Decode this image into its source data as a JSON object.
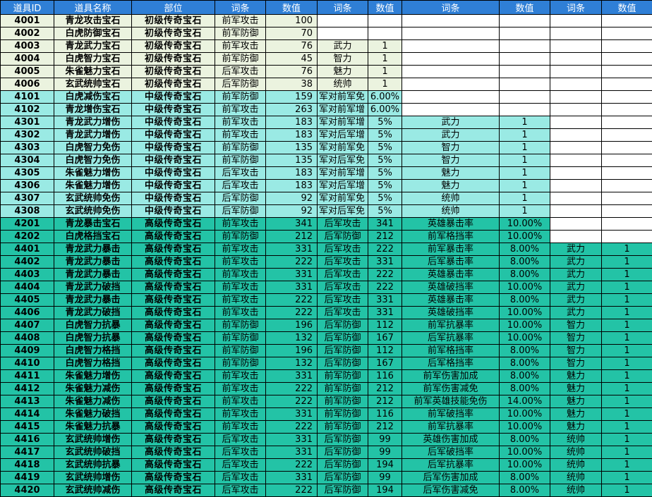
{
  "headers": [
    "道具ID",
    "道具名称",
    "部位",
    "词条",
    "数值",
    "词条",
    "数值",
    "词条",
    "数值",
    "词条",
    "数值"
  ],
  "rows": [
    {
      "tier": "tier1",
      "cells": [
        "4001",
        "青龙攻击宝石",
        "初级传奇宝石",
        "前军攻击",
        "100",
        "",
        "",
        "",
        "",
        "",
        ""
      ]
    },
    {
      "tier": "tier1",
      "cells": [
        "4002",
        "白虎防御宝石",
        "初级传奇宝石",
        "前军防御",
        "70",
        "",
        "",
        "",
        "",
        "",
        ""
      ]
    },
    {
      "tier": "tier1",
      "cells": [
        "4003",
        "青龙武力宝石",
        "初级传奇宝石",
        "前军攻击",
        "76",
        "武力",
        "1",
        "",
        "",
        "",
        ""
      ]
    },
    {
      "tier": "tier1",
      "cells": [
        "4004",
        "白虎智力宝石",
        "初级传奇宝石",
        "前军防御",
        "45",
        "智力",
        "1",
        "",
        "",
        "",
        ""
      ]
    },
    {
      "tier": "tier1",
      "cells": [
        "4005",
        "朱雀魅力宝石",
        "初级传奇宝石",
        "后军攻击",
        "76",
        "魅力",
        "1",
        "",
        "",
        "",
        ""
      ]
    },
    {
      "tier": "tier1",
      "cells": [
        "4006",
        "玄武统帅宝石",
        "初级传奇宝石",
        "后军防御",
        "38",
        "统帅",
        "1",
        "",
        "",
        "",
        ""
      ]
    },
    {
      "tier": "tier2",
      "cells": [
        "4101",
        "白虎减伤宝石",
        "中级传奇宝石",
        "前军防御",
        "159",
        "军对前军免",
        "6.00%",
        "",
        "",
        "",
        ""
      ]
    },
    {
      "tier": "tier2",
      "cells": [
        "4102",
        "青龙增伤宝石",
        "中级传奇宝石",
        "前军攻击",
        "263",
        "军对前军增",
        "6.00%",
        "",
        "",
        "",
        ""
      ]
    },
    {
      "tier": "tier2",
      "cells": [
        "4301",
        "青龙武力增伤",
        "中级传奇宝石",
        "前军攻击",
        "183",
        "军对前军增",
        "5%",
        "武力",
        "1",
        "",
        ""
      ]
    },
    {
      "tier": "tier2",
      "cells": [
        "4302",
        "青龙武力增伤",
        "中级传奇宝石",
        "前军攻击",
        "183",
        "军对后军增",
        "5%",
        "武力",
        "1",
        "",
        ""
      ]
    },
    {
      "tier": "tier2",
      "cells": [
        "4303",
        "白虎智力免伤",
        "中级传奇宝石",
        "前军防御",
        "135",
        "军对前军免",
        "5%",
        "智力",
        "1",
        "",
        ""
      ]
    },
    {
      "tier": "tier2",
      "cells": [
        "4304",
        "白虎智力免伤",
        "中级传奇宝石",
        "前军防御",
        "135",
        "军对后军免",
        "5%",
        "智力",
        "1",
        "",
        ""
      ]
    },
    {
      "tier": "tier2",
      "cells": [
        "4305",
        "朱雀魅力增伤",
        "中级传奇宝石",
        "后军攻击",
        "183",
        "军对前军增",
        "5%",
        "魅力",
        "1",
        "",
        ""
      ]
    },
    {
      "tier": "tier2",
      "cells": [
        "4306",
        "朱雀魅力增伤",
        "中级传奇宝石",
        "后军攻击",
        "183",
        "军对后军增",
        "5%",
        "魅力",
        "1",
        "",
        ""
      ]
    },
    {
      "tier": "tier2",
      "cells": [
        "4307",
        "玄武统帅免伤",
        "中级传奇宝石",
        "后军防御",
        "92",
        "军对前军免",
        "5%",
        "统帅",
        "1",
        "",
        ""
      ]
    },
    {
      "tier": "tier2",
      "cells": [
        "4308",
        "玄武统帅免伤",
        "中级传奇宝石",
        "后军防御",
        "92",
        "军对后军免",
        "5%",
        "统帅",
        "1",
        "",
        ""
      ]
    },
    {
      "tier": "tier3",
      "cells": [
        "4201",
        "青龙暴击宝石",
        "高级传奇宝石",
        "前军攻击",
        "341",
        "后军攻击",
        "341",
        "英雄暴击率",
        "10.00%",
        "",
        ""
      ]
    },
    {
      "tier": "tier3",
      "cells": [
        "4202",
        "白虎格挡宝石",
        "高级传奇宝石",
        "前军防御",
        "212",
        "后军防御",
        "212",
        "前军格挡率",
        "10.00%",
        "",
        ""
      ]
    },
    {
      "tier": "tier3",
      "cells": [
        "4401",
        "青龙武力暴击",
        "高级传奇宝石",
        "前军攻击",
        "331",
        "后军攻击",
        "222",
        "前军暴击率",
        "8.00%",
        "武力",
        "1"
      ]
    },
    {
      "tier": "tier3",
      "cells": [
        "4402",
        "青龙武力暴击",
        "高级传奇宝石",
        "前军攻击",
        "222",
        "后军攻击",
        "331",
        "后军暴击率",
        "8.00%",
        "武力",
        "1"
      ]
    },
    {
      "tier": "tier3",
      "cells": [
        "4403",
        "青龙武力暴击",
        "高级传奇宝石",
        "前军攻击",
        "331",
        "后军攻击",
        "222",
        "英雄暴击率",
        "8.00%",
        "武力",
        "1"
      ]
    },
    {
      "tier": "tier3",
      "cells": [
        "4404",
        "青龙武力破挡",
        "高级传奇宝石",
        "前军攻击",
        "331",
        "后军攻击",
        "222",
        "英雄破挡率",
        "10.00%",
        "武力",
        "1"
      ]
    },
    {
      "tier": "tier3",
      "cells": [
        "4405",
        "青龙武力暴击",
        "高级传奇宝石",
        "前军攻击",
        "222",
        "后军攻击",
        "331",
        "英雄暴击率",
        "8.00%",
        "武力",
        "1"
      ]
    },
    {
      "tier": "tier3",
      "cells": [
        "4406",
        "青龙武力破挡",
        "高级传奇宝石",
        "前军攻击",
        "222",
        "后军攻击",
        "331",
        "英雄破挡率",
        "10.00%",
        "武力",
        "1"
      ]
    },
    {
      "tier": "tier3",
      "cells": [
        "4407",
        "白虎智力抗暴",
        "高级传奇宝石",
        "前军防御",
        "196",
        "后军防御",
        "112",
        "前军抗暴率",
        "10.00%",
        "智力",
        "1"
      ]
    },
    {
      "tier": "tier3",
      "cells": [
        "4408",
        "白虎智力抗暴",
        "高级传奇宝石",
        "前军防御",
        "132",
        "后军防御",
        "167",
        "后军抗暴率",
        "10.00%",
        "智力",
        "1"
      ]
    },
    {
      "tier": "tier3",
      "cells": [
        "4409",
        "白虎智力格挡",
        "高级传奇宝石",
        "前军防御",
        "196",
        "后军防御",
        "112",
        "前军格挡率",
        "8.00%",
        "智力",
        "1"
      ]
    },
    {
      "tier": "tier3",
      "cells": [
        "4410",
        "白虎智力格挡",
        "高级传奇宝石",
        "前军防御",
        "132",
        "后军防御",
        "167",
        "后军格挡率",
        "8.00%",
        "智力",
        "1"
      ]
    },
    {
      "tier": "tier3",
      "cells": [
        "4411",
        "朱雀魅力增伤",
        "高级传奇宝石",
        "前军攻击",
        "331",
        "前军防御",
        "116",
        "前军伤害加成",
        "8.00%",
        "魅力",
        "1"
      ]
    },
    {
      "tier": "tier3",
      "cells": [
        "4412",
        "朱雀魅力减伤",
        "高级传奇宝石",
        "前军攻击",
        "222",
        "前军防御",
        "212",
        "前军伤害减免",
        "8.00%",
        "魅力",
        "1"
      ]
    },
    {
      "tier": "tier3",
      "cells": [
        "4413",
        "朱雀魅力减伤",
        "高级传奇宝石",
        "前军攻击",
        "222",
        "前军防御",
        "212",
        "前军英雄技能免伤",
        "14.00%",
        "魅力",
        "1"
      ]
    },
    {
      "tier": "tier3",
      "cells": [
        "4414",
        "朱雀魅力破挡",
        "高级传奇宝石",
        "前军攻击",
        "331",
        "前军防御",
        "116",
        "前军破挡率",
        "10.00%",
        "魅力",
        "1"
      ]
    },
    {
      "tier": "tier3",
      "cells": [
        "4415",
        "朱雀魅力抗暴",
        "高级传奇宝石",
        "前军攻击",
        "222",
        "前军防御",
        "212",
        "前军抗暴率",
        "10.00%",
        "魅力",
        "1"
      ]
    },
    {
      "tier": "tier3",
      "cells": [
        "4416",
        "玄武统帅增伤",
        "高级传奇宝石",
        "后军攻击",
        "331",
        "后军防御",
        "99",
        "英雄伤害加成",
        "8.00%",
        "统帅",
        "1"
      ]
    },
    {
      "tier": "tier3",
      "cells": [
        "4417",
        "玄武统帅破挡",
        "高级传奇宝石",
        "后军攻击",
        "331",
        "后军防御",
        "99",
        "后军破挡率",
        "10.00%",
        "统帅",
        "1"
      ]
    },
    {
      "tier": "tier3",
      "cells": [
        "4418",
        "玄武统帅抗暴",
        "高级传奇宝石",
        "后军攻击",
        "222",
        "后军防御",
        "194",
        "后军抗暴率",
        "10.00%",
        "统帅",
        "1"
      ]
    },
    {
      "tier": "tier3",
      "cells": [
        "4419",
        "玄武统帅增伤",
        "高级传奇宝石",
        "后军攻击",
        "331",
        "后军防御",
        "99",
        "后军伤害加成",
        "8.00%",
        "统帅",
        "1"
      ]
    },
    {
      "tier": "tier3",
      "cells": [
        "4420",
        "玄武统帅减伤",
        "高级传奇宝石",
        "后军攻击",
        "222",
        "后军防御",
        "194",
        "后军伤害减免",
        "8.00%",
        "统帅",
        "1"
      ]
    }
  ],
  "colors": {
    "header": "#2f7fd6",
    "tier1": "#ebf3df",
    "tier2": "#9aeae4",
    "tier3": "#23c3a6"
  }
}
